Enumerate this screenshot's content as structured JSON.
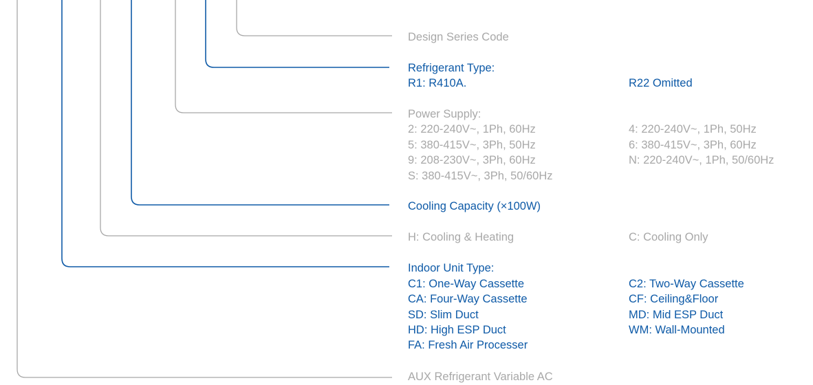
{
  "colors": {
    "blue": "#0e5aa7",
    "gray": "#a8a8a8"
  },
  "groups": [
    {
      "id": "design-series",
      "color": "gray",
      "title": "Design Series Code",
      "left": [],
      "right": []
    },
    {
      "id": "refrigerant",
      "color": "blue",
      "title": "Refrigerant Type:",
      "left": [
        "R1: R410A."
      ],
      "right": [
        "R22 Omitted"
      ]
    },
    {
      "id": "power-supply",
      "color": "gray",
      "title": "Power Supply:",
      "left": [
        "2: 220-240V~, 1Ph, 60Hz",
        "5: 380-415V~, 3Ph, 50Hz",
        "9: 208-230V~, 3Ph, 60Hz",
        "S: 380-415V~, 3Ph, 50/60Hz"
      ],
      "right": [
        "4: 220-240V~, 1Ph, 50Hz",
        "6: 380-415V~, 3Ph, 60Hz",
        "N: 220-240V~, 1Ph, 50/60Hz"
      ]
    },
    {
      "id": "cooling-capacity",
      "color": "blue",
      "title": "Cooling Capacity (×100W)",
      "left": [],
      "right": []
    },
    {
      "id": "function",
      "color": "gray",
      "title": "H: Cooling & Heating",
      "left": [],
      "right": [
        "C: Cooling Only"
      ]
    },
    {
      "id": "indoor-unit-type",
      "color": "blue",
      "title": "Indoor Unit Type:",
      "left": [
        "C1: One-Way Cassette",
        "CA: Four-Way Cassette",
        "SD: Slim Duct",
        "HD: High ESP Duct",
        "FA: Fresh Air Processer"
      ],
      "right": [
        "C2: Two-Way Cassette",
        "CF: Ceiling&Floor",
        "MD: Mid ESP Duct",
        "WM: Wall-Mounted"
      ]
    },
    {
      "id": "brand",
      "color": "gray",
      "title": "AUX Refrigerant Variable AC",
      "left": [],
      "right": []
    }
  ]
}
